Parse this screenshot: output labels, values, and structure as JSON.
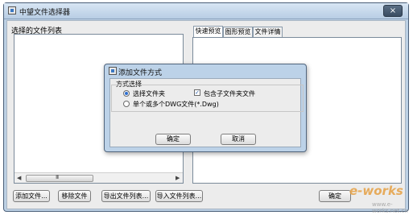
{
  "main_window": {
    "title": "中望文件选择器",
    "close_label": "×"
  },
  "left_panel": {
    "label": "选择的文件列表",
    "scroll_left": "◀",
    "scroll_right": "▶",
    "scroll_grip": "III"
  },
  "tabs": [
    {
      "label": "快速预览",
      "active": true
    },
    {
      "label": "图形预览",
      "active": false
    },
    {
      "label": "文件详情",
      "active": false
    }
  ],
  "buttons": {
    "add_file": "添加文件...",
    "remove_file": "移除文件",
    "export_list": "导出文件列表...",
    "import_list": "导入文件列表...",
    "ok_partial": "确定"
  },
  "dialog": {
    "title": "添加文件方式",
    "group_label": "方式选择",
    "options": [
      {
        "label": "选择文件夹",
        "selected": true
      },
      {
        "label": "单个或多个DWG文件(*.Dwg)",
        "selected": false
      }
    ],
    "checkbox": {
      "label": "包含子文件夹文件",
      "checked": true,
      "mark": "✓"
    },
    "ok_label": "确定",
    "cancel_label": "取消"
  },
  "watermark": {
    "text": "e-works",
    "sub": "www.e-works.net.cn"
  }
}
